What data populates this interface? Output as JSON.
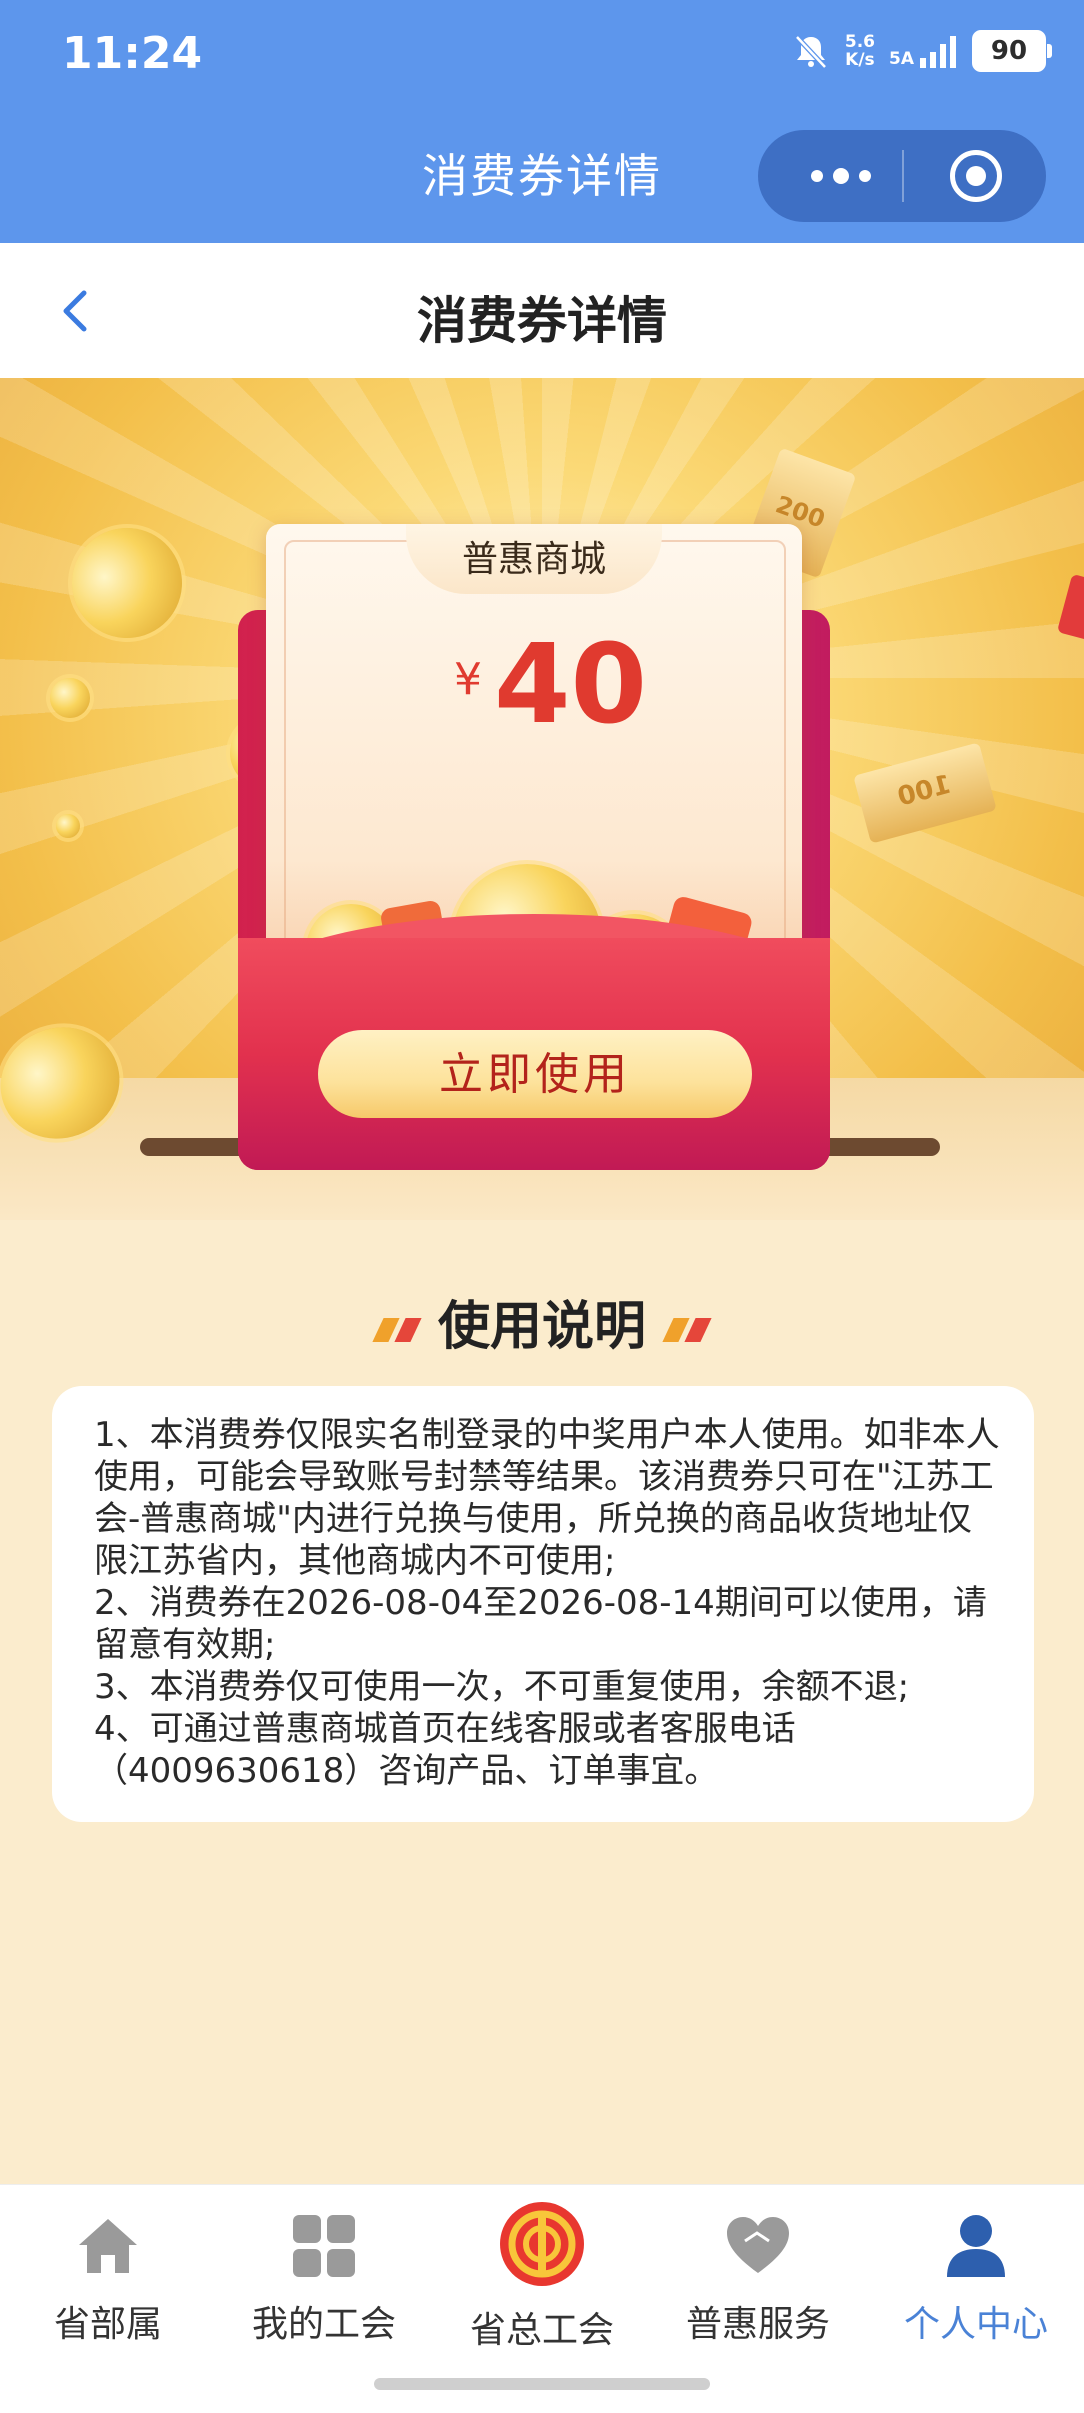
{
  "status_bar": {
    "time": "11:24",
    "net_speed_value": "5.6",
    "net_speed_unit": "K/s",
    "signal_label": "5A",
    "battery": "90"
  },
  "mini_program": {
    "title": "消费券详情"
  },
  "header": {
    "title": "消费券详情"
  },
  "coupon": {
    "mall_label": "普惠商城",
    "currency_symbol": "¥",
    "amount": "40",
    "use_button": "立即使用",
    "decor_ticket_text": "200",
    "decor_ticket_text_2": "100"
  },
  "instructions": {
    "title": "使用说明",
    "items": [
      "1、本消费券仅限实名制登录的中奖用户本人使用。如非本人使用，可能会导致账号封禁等结果。该消费券只可在\"江苏工会-普惠商城\"内进行兑换与使用，所兑换的商品收货地址仅限江苏省内，其他商城内不可使用;",
      "2、消费券在2026-08-04至2026-08-14期间可以使用，请留意有效期;",
      "3、本消费券仅可使用一次，不可重复使用，余额不退;",
      "4、可通过普惠商城首页在线客服或者客服电话（4009630618）咨询产品、订单事宜。"
    ]
  },
  "tabbar": {
    "items": [
      {
        "label": "省部属",
        "icon": "home-icon"
      },
      {
        "label": "我的工会",
        "icon": "grid-icon"
      },
      {
        "label": "省总工会",
        "icon": "union-emblem-icon"
      },
      {
        "label": "普惠服务",
        "icon": "heart-handshake-icon"
      },
      {
        "label": "个人中心",
        "icon": "person-icon"
      }
    ],
    "active_index": 4
  },
  "colors": {
    "primary_blue": "#5d96ec",
    "active_tab": "#4a82d6",
    "price_red": "#e03a2f",
    "page_bg": "#fbeccd"
  }
}
